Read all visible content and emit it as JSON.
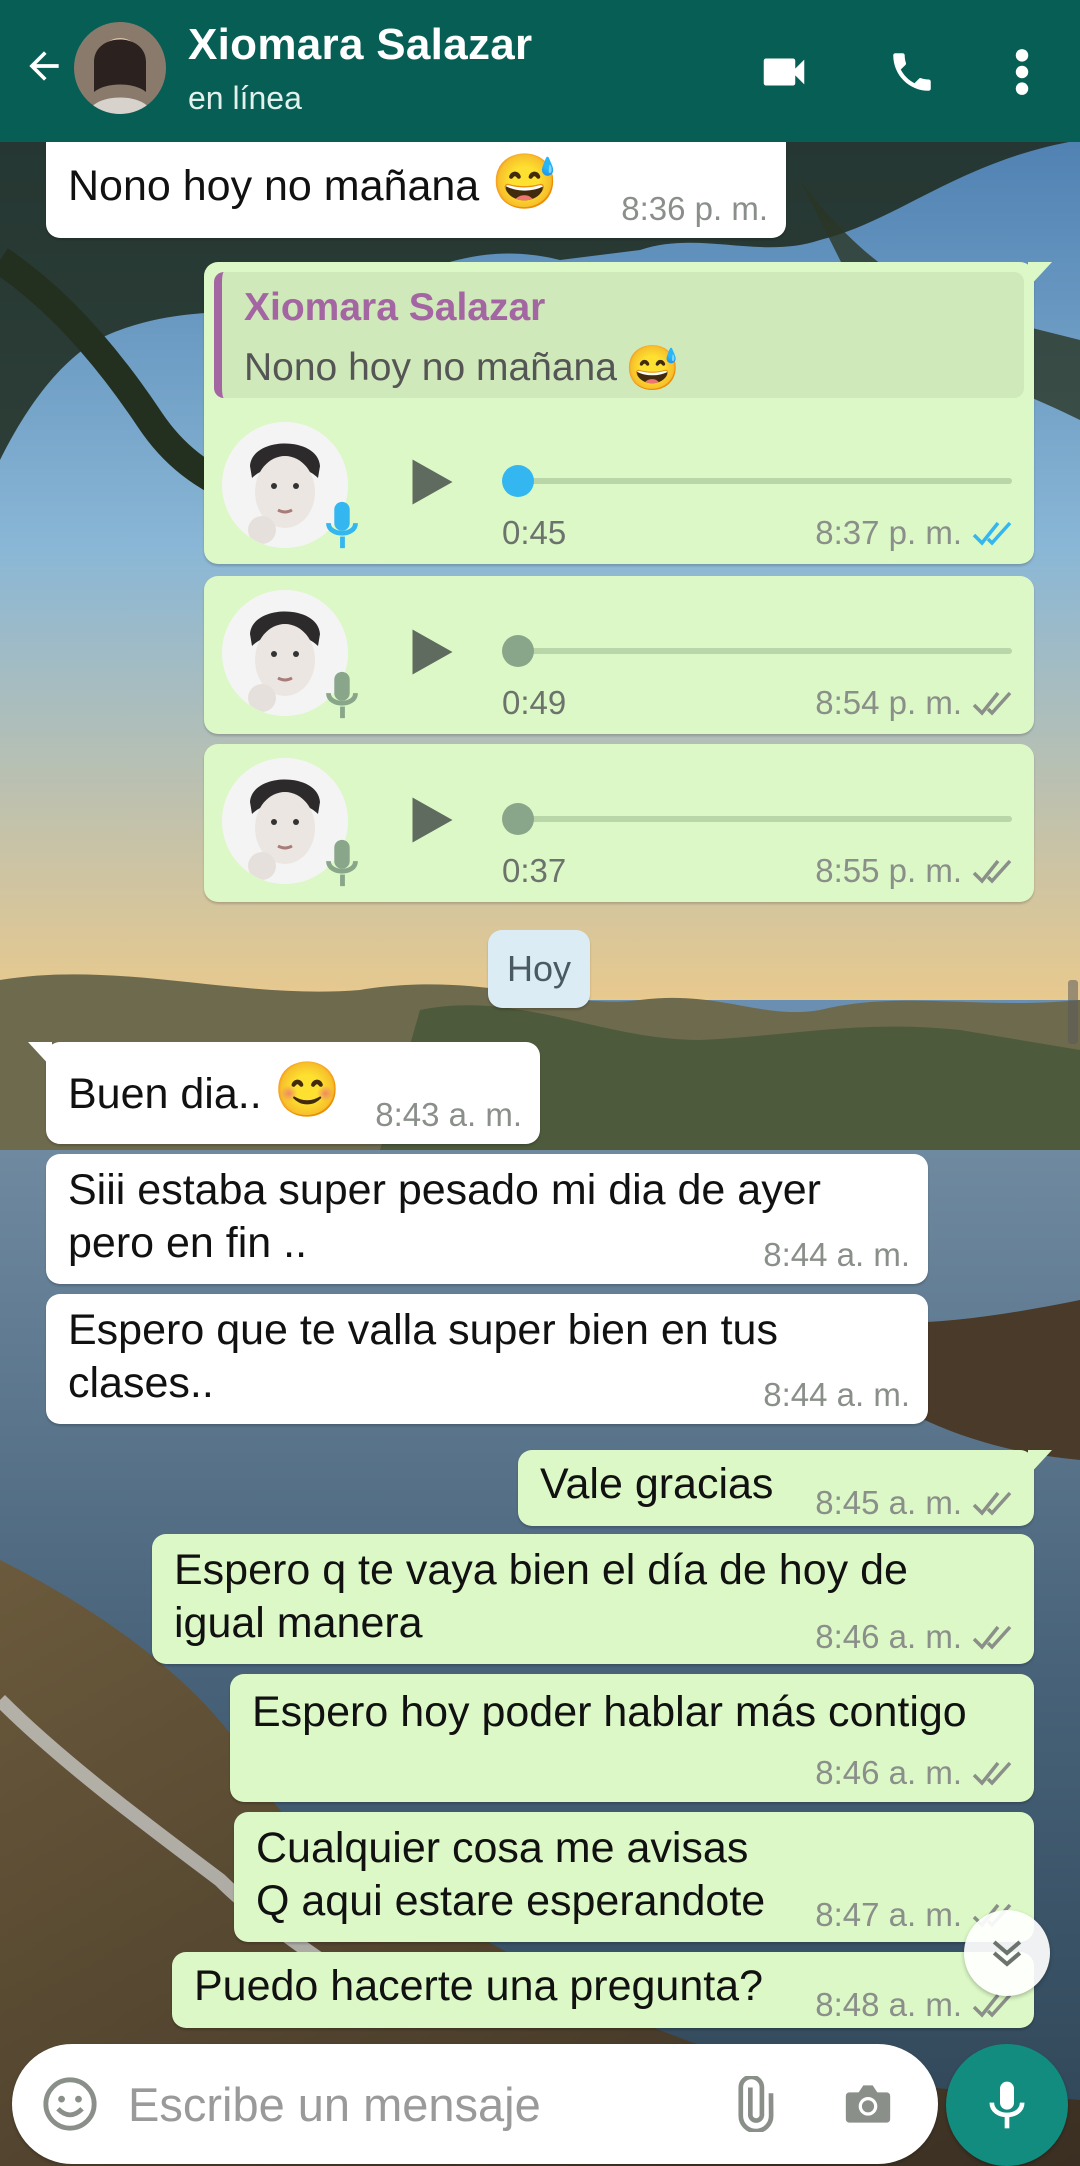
{
  "header": {
    "contact_name": "Xiomara Salazar",
    "status": "en línea",
    "icons": [
      "back-arrow-icon",
      "video-call-icon",
      "phone-icon",
      "more-options-icon"
    ]
  },
  "messages": [
    {
      "dir": "in",
      "text": "Nono hoy no mañana",
      "emoji": "😅",
      "time": "8:36 p. m."
    },
    {
      "dir": "out",
      "type": "voice-reply",
      "quote_name": "Xiomara Salazar",
      "quote_text": "Nono hoy no mañana",
      "quote_emoji": "😅",
      "duration": "0:45",
      "time": "8:37 p. m.",
      "read": true
    },
    {
      "dir": "out",
      "type": "voice",
      "duration": "0:49",
      "time": "8:54 p. m.",
      "read": false
    },
    {
      "dir": "out",
      "type": "voice",
      "duration": "0:37",
      "time": "8:55 p. m.",
      "read": false
    },
    {
      "dir": "in",
      "text": "Buen dia..",
      "emoji": "😊",
      "time": "8:43 a. m."
    },
    {
      "dir": "in",
      "lines": [
        "Siii estaba super pesado mi dia de ayer",
        "pero en fin .."
      ],
      "time": "8:44 a. m."
    },
    {
      "dir": "in",
      "lines": [
        "Espero que te valla super bien en tus",
        "clases.."
      ],
      "time": "8:44 a. m."
    },
    {
      "dir": "out",
      "text": "Vale gracias",
      "time": "8:45 a. m."
    },
    {
      "dir": "out",
      "lines": [
        "Espero q te vaya bien el día de hoy de",
        "igual manera"
      ],
      "time": "8:46 a. m."
    },
    {
      "dir": "out",
      "text": "Espero hoy poder hablar más contigo",
      "time": "8:46 a. m."
    },
    {
      "dir": "out",
      "lines": [
        "Cualquier cosa me avisas",
        "Q aqui estare esperandote"
      ],
      "time": "8:47 a. m."
    },
    {
      "dir": "out",
      "text": "Puedo hacerte una pregunta?",
      "time": "8:48 a. m."
    }
  ],
  "day_divider": "Hoy",
  "input": {
    "placeholder": "Escribe un mensaje"
  },
  "colors": {
    "header": "#075e54",
    "outgoing_bubble": "#dcf8c6",
    "incoming_bubble": "#ffffff",
    "read_tick": "#34b7f1",
    "fab": "#128c7e"
  }
}
